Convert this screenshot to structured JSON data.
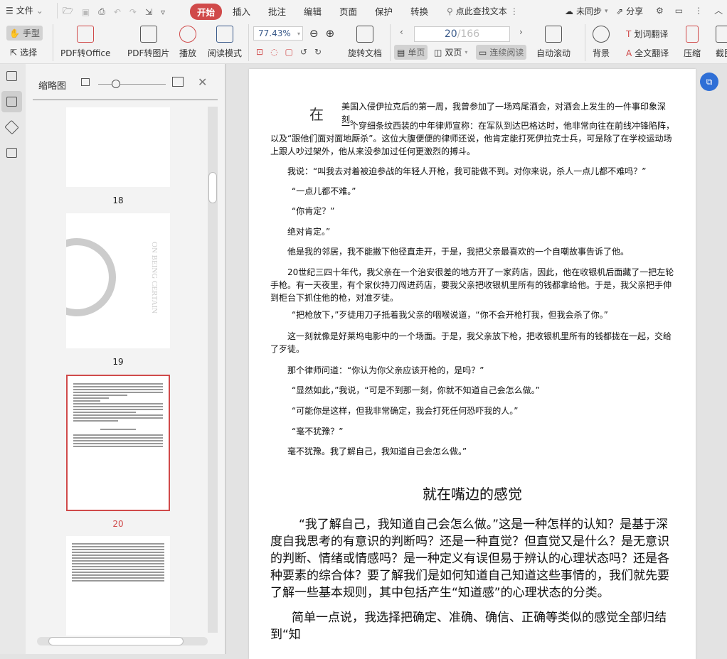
{
  "menu": {
    "file": "文件",
    "tabs": [
      "开始",
      "插入",
      "批注",
      "编辑",
      "页面",
      "保护",
      "转换"
    ],
    "search_placeholder": "点此查找文本",
    "sync": "未同步",
    "share": "分享"
  },
  "toolbar": {
    "hand": "手型",
    "select": "选择",
    "pdf_to_office": "PDF转Office",
    "pdf_to_image": "PDF转图片",
    "play": "播放",
    "read_mode": "阅读模式",
    "zoom": "77.43%",
    "rotate": "旋转文档",
    "page_current": "20",
    "page_total": "/166",
    "single": "单页",
    "double": "双页",
    "continuous": "连续阅读",
    "auto_scroll": "自动滚动",
    "background": "背景",
    "word_translate": "划词翻译",
    "full_translate": "全文翻译",
    "compress": "压缩",
    "screenshot": "截图"
  },
  "panel": {
    "title": "缩略图",
    "pages": [
      "18",
      "19",
      "20"
    ],
    "cover_title": "ON BEING CERTAIN",
    "accent": "#d04a4a"
  },
  "document": {
    "dropcap": "在",
    "paras": [
      "美国入侵伊拉克后的第一周，我曾参加了一场鸡尾酒会，对酒会上发生的一件事印象深刻。",
      "一个穿细条纹西装的中年律师宣称：在军队到达巴格达时，他非常向往在前线冲锋陷阵，以及“跟他们面对面地厮杀”。这位大腹便便的律师还说，他肯定能打死伊拉克士兵，可是除了在学校运动场上跟人吵过架外，他从来没参加过任何更激烈的搏斗。",
      "我说：“叫我去对着被迫参战的年轻人开枪，我可能做不到。对你来说，杀人一点儿都不难吗？”",
      "“一点儿都不难。”",
      "“你肯定？”",
      "绝对肯定。”",
      "他是我的邻居，我不能撇下他径直走开，于是，我把父亲最喜欢的一个自嘲故事告诉了他。",
      "20世纪三四十年代，我父亲在一个治安很差的地方开了一家药店，因此，他在收银机后面藏了一把左轮手枪。有一天夜里，有个家伙持刀闯进药店，要我父亲把收银机里所有的钱都拿给他。于是，我父亲把手伸到柜台下抓住他的枪，对准歹徒。",
      "“把枪放下，”歹徒用刀子抵着我父亲的咽喉说道，“你不会开枪打我，但我会杀了你。”",
      "这一刻就像是好莱坞电影中的一个场面。于是，我父亲放下枪，把收银机里所有的钱都拢在一起，交给了歹徒。",
      "那个律师问道：“你认为你父亲应该开枪的，是吗？”",
      "“显然如此，”我说，“可是不到那一刻，你就不知道自己会怎么做。”",
      "“可能你是这样，但我非常确定，我会打死任何恐吓我的人。”",
      "“毫不犹豫？”",
      "毫不犹豫。我了解自己，我知道自己会怎么做。”"
    ],
    "heading": "就在嘴边的感觉",
    "paras2": [
      "“我了解自己，我知道自己会怎么做。”这是一种怎样的认知？是基于深度自我思考的有意识的判断吗？还是一种直觉？但直觉又是什么？是无意识的判断、情绪或情感吗？是一种定义有误但易于辨认的心理状态吗？还是各种要素的综合体？要了解我们是如何知道自己知道这些事情的，我们就先要了解一些基本规则，其中包括产生“知道感”的心理状态的分类。",
      "简单一点说，我选择把确定、准确、确信、正确等类似的感觉全部归结到“知"
    ]
  }
}
